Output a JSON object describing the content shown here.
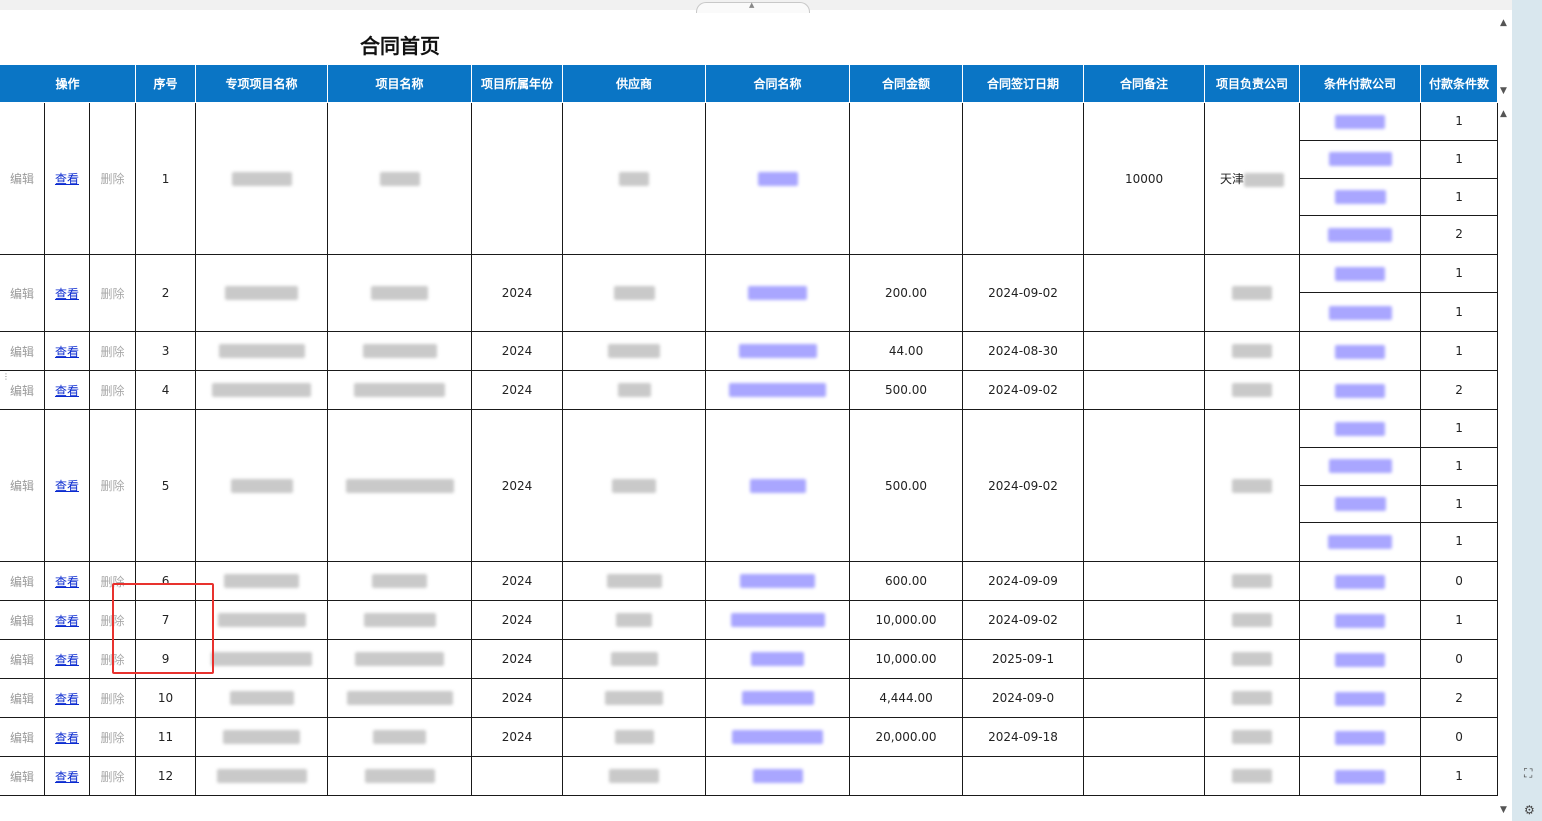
{
  "page": {
    "title": "合同首页"
  },
  "table": {
    "headers": [
      "操作",
      "序号",
      "专项项目名称",
      "项目名称",
      "项目所属年份",
      "供应商",
      "合同名称",
      "合同金额",
      "合同签订日期",
      "合同备注",
      "项目负责公司",
      "条件付款公司",
      "付款条件数"
    ],
    "actions": {
      "edit": "编辑",
      "view": "查看",
      "delete": "删除"
    },
    "rows": [
      {
        "seq": "1",
        "year": "",
        "amount": "",
        "date": "",
        "remark": "10000",
        "company": "天津",
        "counts": [
          "1",
          "1",
          "1",
          "2"
        ]
      },
      {
        "seq": "2",
        "year": "2024",
        "amount": "200.00",
        "date": "2024-09-02",
        "remark": "",
        "company": "",
        "counts": [
          "1",
          "1"
        ]
      },
      {
        "seq": "3",
        "year": "2024",
        "amount": "44.00",
        "date": "2024-08-30",
        "remark": "",
        "company": "",
        "counts": [
          "1"
        ]
      },
      {
        "seq": "4",
        "year": "2024",
        "amount": "500.00",
        "date": "2024-09-02",
        "remark": "",
        "company": "",
        "counts": [
          "2"
        ]
      },
      {
        "seq": "5",
        "year": "2024",
        "amount": "500.00",
        "date": "2024-09-02",
        "remark": "",
        "company": "",
        "counts": [
          "1",
          "1",
          "1",
          "1"
        ]
      },
      {
        "seq": "6",
        "year": "2024",
        "amount": "600.00",
        "date": "2024-09-09",
        "remark": "",
        "company": "",
        "counts": [
          "0"
        ]
      },
      {
        "seq": "7",
        "year": "2024",
        "amount": "10,000.00",
        "date": "2024-09-02",
        "remark": "",
        "company": "",
        "counts": [
          "1"
        ]
      },
      {
        "seq": "9",
        "year": "2024",
        "amount": "10,000.00",
        "date": "2025-09-1",
        "remark": "",
        "company": "",
        "counts": [
          "0"
        ]
      },
      {
        "seq": "10",
        "year": "2024",
        "amount": "4,444.00",
        "date": "2024-09-0",
        "remark": "",
        "company": "",
        "counts": [
          "2"
        ]
      },
      {
        "seq": "11",
        "year": "2024",
        "amount": "20,000.00",
        "date": "2024-09-18",
        "remark": "",
        "company": "",
        "counts": [
          "0"
        ]
      },
      {
        "seq": "12",
        "year": "",
        "amount": "",
        "date": "",
        "remark": "",
        "company": "",
        "counts": [
          "1"
        ]
      }
    ]
  },
  "colors": {
    "header_bg": "#0a75c5",
    "link": "#0b2bd0",
    "highlight_box": "#e8322e"
  },
  "icons": {
    "scroll_up": "triangle-up-icon",
    "scroll_down": "triangle-down-icon"
  }
}
